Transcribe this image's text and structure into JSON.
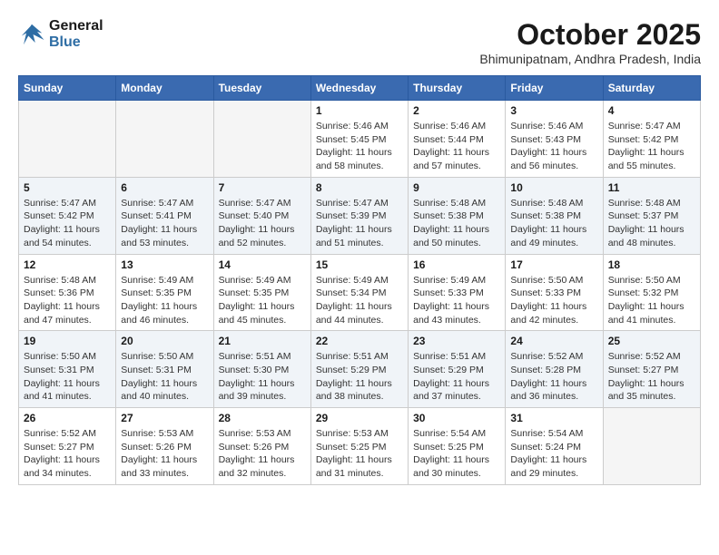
{
  "header": {
    "logo_line1": "General",
    "logo_line2": "Blue",
    "month": "October 2025",
    "location": "Bhimunipatnam, Andhra Pradesh, India"
  },
  "weekdays": [
    "Sunday",
    "Monday",
    "Tuesday",
    "Wednesday",
    "Thursday",
    "Friday",
    "Saturday"
  ],
  "weeks": [
    [
      {
        "day": "",
        "info": ""
      },
      {
        "day": "",
        "info": ""
      },
      {
        "day": "",
        "info": ""
      },
      {
        "day": "1",
        "info": "Sunrise: 5:46 AM\nSunset: 5:45 PM\nDaylight: 11 hours\nand 58 minutes."
      },
      {
        "day": "2",
        "info": "Sunrise: 5:46 AM\nSunset: 5:44 PM\nDaylight: 11 hours\nand 57 minutes."
      },
      {
        "day": "3",
        "info": "Sunrise: 5:46 AM\nSunset: 5:43 PM\nDaylight: 11 hours\nand 56 minutes."
      },
      {
        "day": "4",
        "info": "Sunrise: 5:47 AM\nSunset: 5:42 PM\nDaylight: 11 hours\nand 55 minutes."
      }
    ],
    [
      {
        "day": "5",
        "info": "Sunrise: 5:47 AM\nSunset: 5:42 PM\nDaylight: 11 hours\nand 54 minutes."
      },
      {
        "day": "6",
        "info": "Sunrise: 5:47 AM\nSunset: 5:41 PM\nDaylight: 11 hours\nand 53 minutes."
      },
      {
        "day": "7",
        "info": "Sunrise: 5:47 AM\nSunset: 5:40 PM\nDaylight: 11 hours\nand 52 minutes."
      },
      {
        "day": "8",
        "info": "Sunrise: 5:47 AM\nSunset: 5:39 PM\nDaylight: 11 hours\nand 51 minutes."
      },
      {
        "day": "9",
        "info": "Sunrise: 5:48 AM\nSunset: 5:38 PM\nDaylight: 11 hours\nand 50 minutes."
      },
      {
        "day": "10",
        "info": "Sunrise: 5:48 AM\nSunset: 5:38 PM\nDaylight: 11 hours\nand 49 minutes."
      },
      {
        "day": "11",
        "info": "Sunrise: 5:48 AM\nSunset: 5:37 PM\nDaylight: 11 hours\nand 48 minutes."
      }
    ],
    [
      {
        "day": "12",
        "info": "Sunrise: 5:48 AM\nSunset: 5:36 PM\nDaylight: 11 hours\nand 47 minutes."
      },
      {
        "day": "13",
        "info": "Sunrise: 5:49 AM\nSunset: 5:35 PM\nDaylight: 11 hours\nand 46 minutes."
      },
      {
        "day": "14",
        "info": "Sunrise: 5:49 AM\nSunset: 5:35 PM\nDaylight: 11 hours\nand 45 minutes."
      },
      {
        "day": "15",
        "info": "Sunrise: 5:49 AM\nSunset: 5:34 PM\nDaylight: 11 hours\nand 44 minutes."
      },
      {
        "day": "16",
        "info": "Sunrise: 5:49 AM\nSunset: 5:33 PM\nDaylight: 11 hours\nand 43 minutes."
      },
      {
        "day": "17",
        "info": "Sunrise: 5:50 AM\nSunset: 5:33 PM\nDaylight: 11 hours\nand 42 minutes."
      },
      {
        "day": "18",
        "info": "Sunrise: 5:50 AM\nSunset: 5:32 PM\nDaylight: 11 hours\nand 41 minutes."
      }
    ],
    [
      {
        "day": "19",
        "info": "Sunrise: 5:50 AM\nSunset: 5:31 PM\nDaylight: 11 hours\nand 41 minutes."
      },
      {
        "day": "20",
        "info": "Sunrise: 5:50 AM\nSunset: 5:31 PM\nDaylight: 11 hours\nand 40 minutes."
      },
      {
        "day": "21",
        "info": "Sunrise: 5:51 AM\nSunset: 5:30 PM\nDaylight: 11 hours\nand 39 minutes."
      },
      {
        "day": "22",
        "info": "Sunrise: 5:51 AM\nSunset: 5:29 PM\nDaylight: 11 hours\nand 38 minutes."
      },
      {
        "day": "23",
        "info": "Sunrise: 5:51 AM\nSunset: 5:29 PM\nDaylight: 11 hours\nand 37 minutes."
      },
      {
        "day": "24",
        "info": "Sunrise: 5:52 AM\nSunset: 5:28 PM\nDaylight: 11 hours\nand 36 minutes."
      },
      {
        "day": "25",
        "info": "Sunrise: 5:52 AM\nSunset: 5:27 PM\nDaylight: 11 hours\nand 35 minutes."
      }
    ],
    [
      {
        "day": "26",
        "info": "Sunrise: 5:52 AM\nSunset: 5:27 PM\nDaylight: 11 hours\nand 34 minutes."
      },
      {
        "day": "27",
        "info": "Sunrise: 5:53 AM\nSunset: 5:26 PM\nDaylight: 11 hours\nand 33 minutes."
      },
      {
        "day": "28",
        "info": "Sunrise: 5:53 AM\nSunset: 5:26 PM\nDaylight: 11 hours\nand 32 minutes."
      },
      {
        "day": "29",
        "info": "Sunrise: 5:53 AM\nSunset: 5:25 PM\nDaylight: 11 hours\nand 31 minutes."
      },
      {
        "day": "30",
        "info": "Sunrise: 5:54 AM\nSunset: 5:25 PM\nDaylight: 11 hours\nand 30 minutes."
      },
      {
        "day": "31",
        "info": "Sunrise: 5:54 AM\nSunset: 5:24 PM\nDaylight: 11 hours\nand 29 minutes."
      },
      {
        "day": "",
        "info": ""
      }
    ]
  ]
}
